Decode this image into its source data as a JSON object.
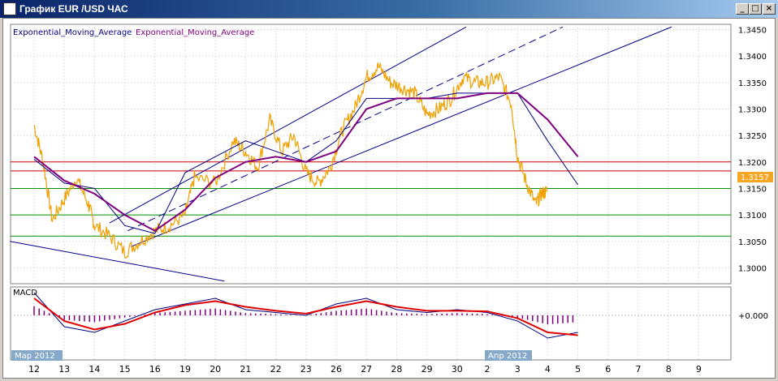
{
  "window": {
    "title": "График EUR /USD  ЧАС",
    "controls": [
      "minimize",
      "maximize",
      "close"
    ]
  },
  "indicator_labels": {
    "ema1": "Exponential_Moving_Average",
    "ema2": "Exponential_Moving_Average",
    "macd": "MACD",
    "macd_zero": "+0.000"
  },
  "current_price": "1.3157",
  "x_axis": {
    "month_labels": [
      "Мар 2012",
      "Апр 2012"
    ],
    "day_labels": [
      "12",
      "13",
      "14",
      "15",
      "16",
      "19",
      "20",
      "21",
      "22",
      "23",
      "26",
      "27",
      "28",
      "29",
      "30",
      "2",
      "3",
      "4",
      "5",
      "6",
      "7",
      "8",
      "9"
    ]
  },
  "colors": {
    "price": "#f0a000",
    "ema_fast": "#000080",
    "ema_slow": "#800080",
    "channel": "#00008b",
    "resistance": "#d00000",
    "support": "#009000",
    "macd_signal": "#e00000",
    "price_tag": "#f5a623"
  },
  "chart_data": [
    {
      "type": "line",
      "title": "",
      "y_ticks": [
        "1.3450",
        "1.3400",
        "1.3350",
        "1.3300",
        "1.3250",
        "1.3200",
        "1.3150",
        "1.3100",
        "1.3050",
        "1.3000"
      ],
      "ylim": [
        1.297,
        1.346
      ],
      "x": [
        "12",
        "13",
        "14",
        "15",
        "16",
        "19",
        "20",
        "21",
        "22",
        "23",
        "26",
        "27",
        "28",
        "29",
        "30",
        "2",
        "3",
        "4",
        "5"
      ],
      "series": [
        {
          "name": "Exponential_Moving_Average",
          "values": [
            1.3205,
            1.316,
            1.315,
            1.308,
            1.3065,
            1.318,
            1.321,
            1.324,
            1.322,
            1.32,
            1.324,
            1.332,
            1.332,
            1.332,
            1.333,
            1.333,
            1.333,
            1.324,
            1.3157
          ]
        },
        {
          "name": "Exponential_Moving_Average",
          "values": [
            1.321,
            1.3165,
            1.314,
            1.31,
            1.307,
            1.311,
            1.317,
            1.32,
            1.321,
            1.32,
            1.322,
            1.33,
            1.332,
            1.332,
            1.332,
            1.333,
            1.333,
            1.328,
            1.321
          ]
        }
      ],
      "price_points": [
        [
          12,
          1.327
        ],
        [
          12.3,
          1.32
        ],
        [
          12.6,
          1.309
        ],
        [
          13,
          1.313
        ],
        [
          13.4,
          1.317
        ],
        [
          13.8,
          1.312
        ],
        [
          14,
          1.308
        ],
        [
          14.5,
          1.306
        ],
        [
          15,
          1.303
        ],
        [
          15.5,
          1.305
        ],
        [
          16,
          1.307
        ],
        [
          16.5,
          1.308
        ],
        [
          17,
          1.31
        ],
        [
          17.3,
          1.317
        ],
        [
          18,
          1.316
        ],
        [
          18.6,
          1.324
        ],
        [
          19,
          1.322
        ],
        [
          19.4,
          1.319
        ],
        [
          19.8,
          1.328
        ],
        [
          20.2,
          1.322
        ],
        [
          20.6,
          1.325
        ],
        [
          21,
          1.318
        ],
        [
          21.4,
          1.316
        ],
        [
          21.8,
          1.319
        ],
        [
          22.2,
          1.326
        ],
        [
          22.6,
          1.33
        ],
        [
          23,
          1.336
        ],
        [
          23.4,
          1.338
        ],
        [
          23.8,
          1.335
        ],
        [
          24.2,
          1.334
        ],
        [
          24.6,
          1.333
        ],
        [
          25,
          1.329
        ],
        [
          25.4,
          1.33
        ],
        [
          25.8,
          1.332
        ],
        [
          26.2,
          1.336
        ],
        [
          26.6,
          1.335
        ],
        [
          27,
          1.335
        ],
        [
          27.4,
          1.336
        ],
        [
          27.8,
          1.331
        ],
        [
          28,
          1.321
        ],
        [
          28.3,
          1.316
        ],
        [
          28.6,
          1.312
        ],
        [
          28.8,
          1.314
        ],
        [
          29,
          1.3145
        ]
      ],
      "channel_lines": "three parallel ascending blue lines (upper, middle dashed, lower) plus one descending line",
      "horizontal_levels": {
        "resistance": [
          1.32,
          1.3183
        ],
        "support": [
          1.315,
          1.31,
          1.306
        ]
      }
    },
    {
      "type": "line",
      "title": "MACD",
      "zero_label": "+0.000",
      "series": [
        {
          "name": "MACD",
          "values": [
            0.004,
            -0.002,
            -0.003,
            -0.001,
            0.001,
            0.002,
            0.003,
            0.001,
            0.0005,
            0.0,
            0.002,
            0.003,
            0.001,
            0.0005,
            0.001,
            0.0005,
            -0.001,
            -0.004,
            -0.003
          ]
        },
        {
          "name": "Signal",
          "values": [
            0.003,
            -0.001,
            -0.0025,
            -0.0015,
            0.0005,
            0.0018,
            0.0025,
            0.0015,
            0.0008,
            0.0003,
            0.0015,
            0.0025,
            0.0015,
            0.0008,
            0.0008,
            0.0007,
            -0.0005,
            -0.003,
            -0.0035
          ]
        }
      ]
    }
  ]
}
